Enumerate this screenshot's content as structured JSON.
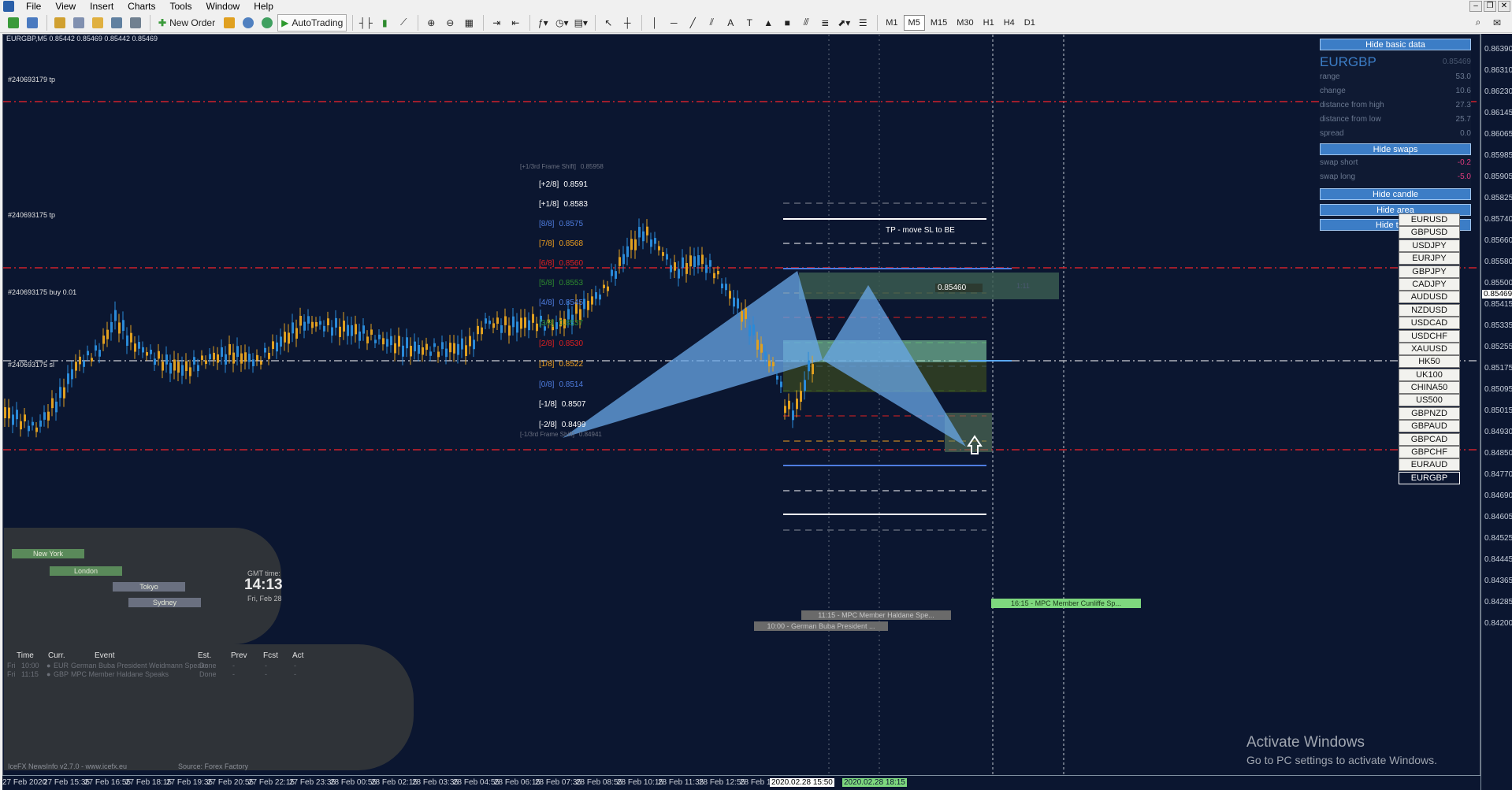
{
  "menu": [
    "File",
    "View",
    "Insert",
    "Charts",
    "Tools",
    "Window",
    "Help"
  ],
  "toolbar": {
    "new_order": "New Order",
    "autotrading": "AutoTrading",
    "timeframes": [
      "M1",
      "M5",
      "M15",
      "M30",
      "H1",
      "H4",
      "D1"
    ],
    "active_timeframe": "M5"
  },
  "chart": {
    "symbol_info": "EURGBP,M5  0.85442 0.85469 0.85442 0.85469",
    "order_labels": [
      {
        "text": "#240693179 tp"
      },
      {
        "text": "#240693175 tp"
      },
      {
        "text": "#240693175 buy 0.01"
      },
      {
        "text": "#240693175 sl"
      }
    ],
    "murrey": [
      {
        "label": "[+1/3rd Frame Shift]",
        "value": "0.85958",
        "color": "#6a7080"
      },
      {
        "label": "[+2/8]",
        "value": "0.8591",
        "color": "#ffffff"
      },
      {
        "label": "[+1/8]",
        "value": "0.8583",
        "color": "#ffffff"
      },
      {
        "label": "[8/8]",
        "value": "0.8575",
        "color": "#4f7de0"
      },
      {
        "label": "[7/8]",
        "value": "0.8568",
        "color": "#f0a020"
      },
      {
        "label": "[6/8]",
        "value": "0.8560",
        "color": "#e02020"
      },
      {
        "label": "[5/8]",
        "value": "0.8553",
        "color": "#2e8b2e"
      },
      {
        "label": "[4/8]",
        "value": "0.8545",
        "color": "#4f7de0"
      },
      {
        "label": "[3/8]",
        "value": "0.8537",
        "color": "#2e8b2e"
      },
      {
        "label": "[2/8]",
        "value": "0.8530",
        "color": "#e02020"
      },
      {
        "label": "[1/8]",
        "value": "0.8522",
        "color": "#f0a020"
      },
      {
        "label": "[0/8]",
        "value": "0.8514",
        "color": "#4f7de0"
      },
      {
        "label": "[-1/8]",
        "value": "0.8507",
        "color": "#ffffff"
      },
      {
        "label": "[-2/8]",
        "value": "0.8499",
        "color": "#ffffff"
      },
      {
        "label": "[-1/3rd Frame Shift]",
        "value": "0.84941",
        "color": "#6a7080"
      }
    ],
    "tp_box_label": "TP - move SL to BE",
    "entry_price_label": "0.85460",
    "ratio_label": "1:11",
    "news_markers": [
      "11:15 - MPC Member Haldane Spe...",
      "10:00 - German Buba President ...",
      "16:15 - MPC Member Cunliffe Sp..."
    ]
  },
  "panel": {
    "hide_basic_data": "Hide basic data",
    "symbol": "EURGBP",
    "symbol_price": "0.85469",
    "rows": [
      {
        "label": "range",
        "value": "53.0"
      },
      {
        "label": "change",
        "value": "10.6"
      },
      {
        "label": "distance from high",
        "value": "27.3"
      },
      {
        "label": "distance from low",
        "value": "25.7"
      },
      {
        "label": "spread",
        "value": "0.0"
      }
    ],
    "hide_swaps": "Hide swaps",
    "swaps": [
      {
        "label": "swap short",
        "value": "-0.2"
      },
      {
        "label": "swap long",
        "value": "-5.0"
      }
    ],
    "hide_candle": "Hide candle",
    "hide_area": "Hide area",
    "hide_timer": "Hide timer"
  },
  "symbols": [
    "EURUSD",
    "GBPUSD",
    "USDJPY",
    "EURJPY",
    "GBPJPY",
    "CADJPY",
    "AUDUSD",
    "NZDUSD",
    "USDCAD",
    "USDCHF",
    "XAUUSD",
    "HK50",
    "UK100",
    "CHINA50",
    "US500",
    "GBPNZD",
    "GBPAUD",
    "GBPCAD",
    "GBPCHF",
    "EURAUD",
    "EURGBP"
  ],
  "active_symbol": "EURGBP",
  "sessions": {
    "new_york": "New York",
    "london": "London",
    "tokyo": "Tokyo",
    "sydney": "Sydney",
    "gmt_label": "GMT time:",
    "gmt_time": "14:13",
    "gmt_date": "Fri, Feb 28"
  },
  "news": {
    "headers": [
      "Time",
      "Curr.",
      "Event",
      "Est.",
      "Prev",
      "Fcst",
      "Act"
    ],
    "rows": [
      {
        "day": "Fri",
        "time": "10:00",
        "curr": "EUR",
        "event": "German Buba President Weidmann Speaks",
        "est": "Done",
        "prev": "-",
        "fcst": "-",
        "act": "-"
      },
      {
        "day": "Fri",
        "time": "11:15",
        "curr": "GBP",
        "event": "MPC Member Haldane Speaks",
        "est": "Done",
        "prev": "-",
        "fcst": "-",
        "act": "-"
      }
    ],
    "footer": "IceFX NewsInfo v2.7.0  -  www.icefx.eu",
    "source": "Source: Forex Factory"
  },
  "price_axis": [
    "0.86390",
    "0.86310",
    "0.86230",
    "0.86145",
    "0.86065",
    "0.85985",
    "0.85905",
    "0.85825",
    "0.85740",
    "0.85660",
    "0.85580",
    "0.85500",
    "0.85469",
    "0.85415",
    "0.85335",
    "0.85255",
    "0.85175",
    "0.85095",
    "0.85015",
    "0.84930",
    "0.84850",
    "0.84770",
    "0.84690",
    "0.84605",
    "0.84525",
    "0.84445",
    "0.84365",
    "0.84285",
    "0.84200"
  ],
  "current_price": "0.85469",
  "time_axis": [
    "27 Feb 2020",
    "27 Feb 15:35",
    "27 Feb 16:55",
    "27 Feb 18:15",
    "27 Feb 19:35",
    "27 Feb 20:55",
    "27 Feb 22:15",
    "27 Feb 23:35",
    "28 Feb 00:55",
    "28 Feb 02:15",
    "28 Feb 03:35",
    "28 Feb 04:55",
    "28 Feb 06:15",
    "28 Feb 07:35",
    "28 Feb 08:55",
    "28 Feb 10:15",
    "28 Feb 11:35",
    "28 Feb 12:55",
    "28 Feb 1",
    "2020.02.28 15:50",
    "2020.02.28 18:15"
  ],
  "activate_windows": {
    "title": "Activate Windows",
    "subtitle": "Go to PC settings to activate Windows."
  }
}
